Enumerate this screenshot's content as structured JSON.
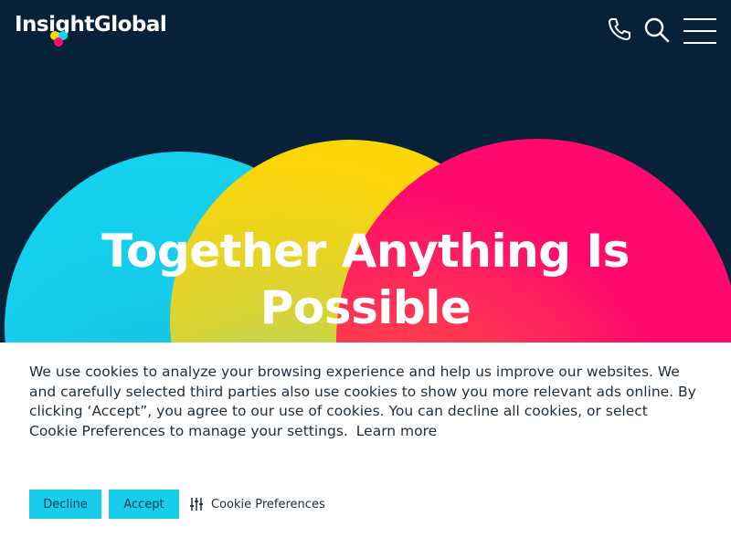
{
  "header": {
    "logo_text": "InsightGlobal",
    "logo_dot_colors": [
      "#fed600",
      "#14d4ef",
      "#ff0a6e"
    ],
    "icons": [
      "phone-icon",
      "search-icon",
      "hamburger-menu-icon"
    ]
  },
  "hero": {
    "headline": "Together Anything Is Possible",
    "circle_colors": [
      "#14d4ef",
      "#fed600",
      "#ff0a6e"
    ],
    "background_color": "#072238"
  },
  "cookie_banner": {
    "message": "We use cookies to analyze your browsing experience and help us improve our websites. We and carefully selected third parties also use cookies to show you more relevant ads online. By clicking ‘Accept”, you agree to our use of cookies. You can decline all cookies, or select Cookie Preferences to manage your settings.",
    "learn_more": "Learn more",
    "decline_label": "Decline",
    "accept_label": "Accept",
    "preferences_label": "Cookie Preferences",
    "button_color": "#16cdeb"
  }
}
